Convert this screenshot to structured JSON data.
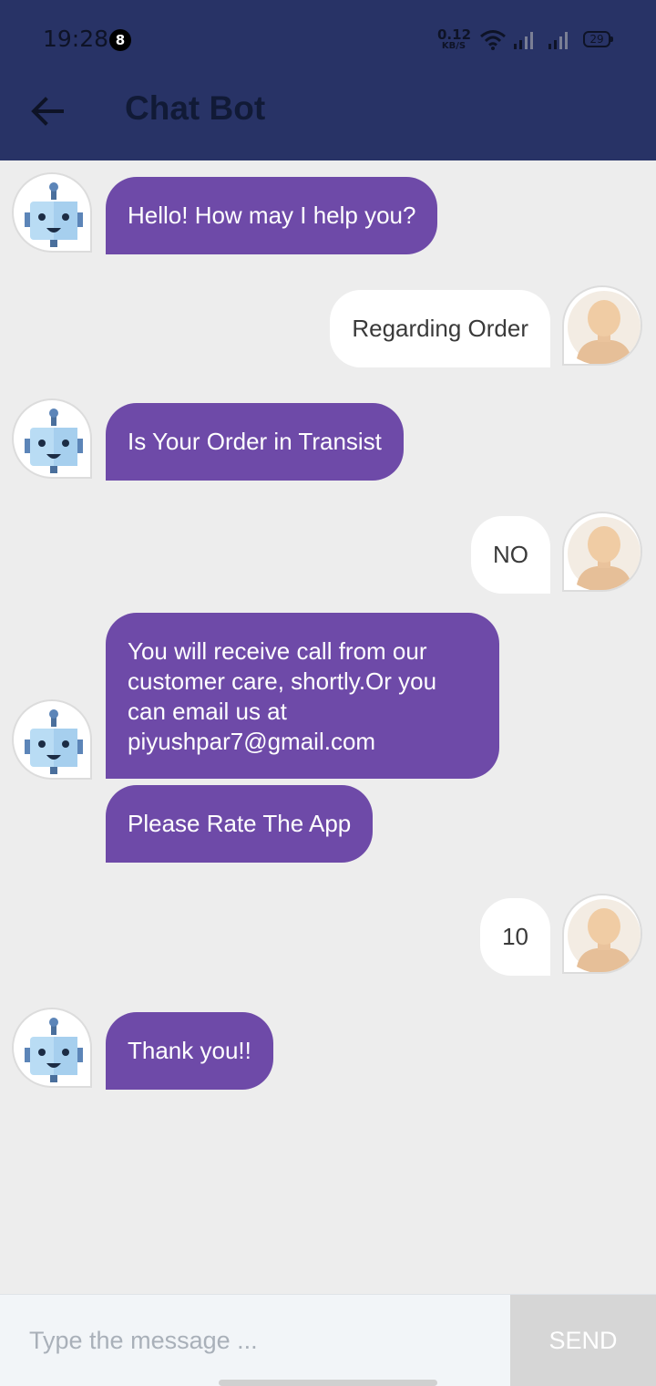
{
  "status_bar": {
    "time": "19:28",
    "notification_count": "8",
    "network_speed_value": "0.12",
    "network_speed_unit": "KB/S",
    "battery": "29",
    "icons": [
      "wifi-icon",
      "signal-icon",
      "signal-icon",
      "battery-icon"
    ]
  },
  "header": {
    "title": "Chat Bot",
    "back_icon": "arrow-left-icon",
    "background_color": "#283366"
  },
  "messages": [
    {
      "sender": "bot",
      "text": "Hello! How may I help you?"
    },
    {
      "sender": "user",
      "text": "Regarding Order"
    },
    {
      "sender": "bot",
      "text": "Is Your Order in Transist"
    },
    {
      "sender": "user",
      "text": "NO"
    },
    {
      "sender": "bot",
      "text": "You will receive call from our customer care, shortly.Or you can email us at piyushpar7@gmail.com"
    },
    {
      "sender": "bot",
      "text": "Please Rate The App"
    },
    {
      "sender": "user",
      "text": "10"
    },
    {
      "sender": "bot",
      "text": "Thank you!!"
    }
  ],
  "colors": {
    "bot_bubble": "#6e4aa8",
    "user_bubble": "#ffffff",
    "chat_background": "#ededed"
  },
  "composer": {
    "placeholder": "Type the message ...",
    "value": "",
    "send_label": "SEND"
  }
}
